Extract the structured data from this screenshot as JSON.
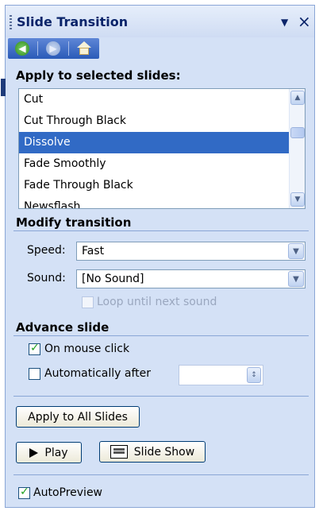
{
  "pane": {
    "title": "Slide Transition",
    "dropdown_icon": "▼",
    "close_icon": "×"
  },
  "nav": {
    "back_icon": "back-arrow-icon",
    "forward_icon": "forward-arrow-icon",
    "home_icon": "home-icon"
  },
  "apply_section": {
    "heading": "Apply to selected slides:",
    "items": [
      "Cut",
      "Cut Through Black",
      "Dissolve",
      "Fade Smoothly",
      "Fade Through Black",
      "Newsflash"
    ],
    "selected": "Dissolve"
  },
  "modify": {
    "heading": "Modify transition",
    "speed_label": "Speed:",
    "speed_value": "Fast",
    "sound_label": "Sound:",
    "sound_value": "[No Sound]",
    "loop_label": "Loop until next sound",
    "loop_checked": false,
    "loop_enabled": false
  },
  "advance": {
    "heading": "Advance slide",
    "on_click_label": "On mouse click",
    "on_click_checked": true,
    "auto_label": "Automatically after",
    "auto_checked": false,
    "auto_value": ""
  },
  "buttons": {
    "apply_all": "Apply to All Slides",
    "play": "Play",
    "slide_show": "Slide Show"
  },
  "autopreview": {
    "label": "AutoPreview",
    "checked": true
  },
  "colors": {
    "pane_bg": "#d4e1f6",
    "title_text": "#0a246a",
    "selection": "#316ac5",
    "check_green": "#21a121"
  }
}
